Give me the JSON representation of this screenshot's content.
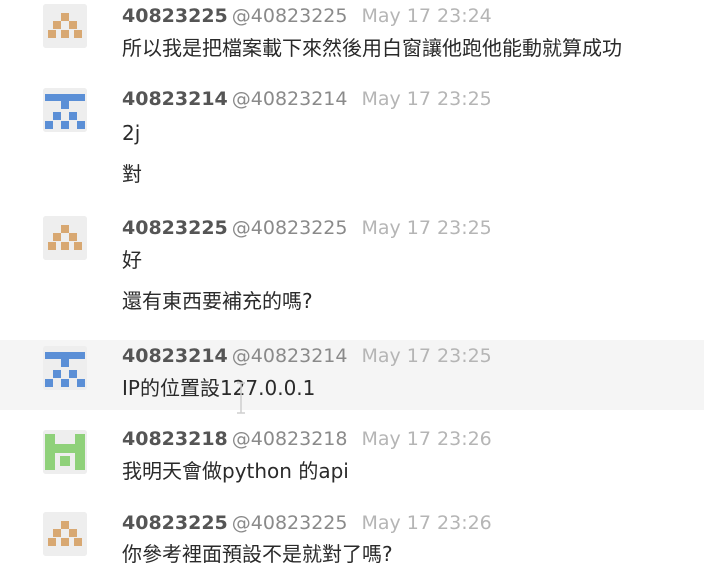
{
  "messages": [
    {
      "user": "40823225",
      "handle": "@40823225",
      "time": "May 17 23:24",
      "avatar_color": "#d8a872",
      "avatar_icon": "identicon-diamond",
      "lines": [
        "所以我是把檔案載下來然後用白窗讓他跑他能動就算成功"
      ]
    },
    {
      "user": "40823214",
      "handle": "@40823214",
      "time": "May 17 23:25",
      "avatar_color": "#5b8fd6",
      "avatar_icon": "identicon-t",
      "lines": [
        "2j",
        "對"
      ]
    },
    {
      "user": "40823225",
      "handle": "@40823225",
      "time": "May 17 23:25",
      "avatar_color": "#d8a872",
      "avatar_icon": "identicon-diamond",
      "lines": [
        "好",
        "還有東西要補充的嗎?"
      ]
    },
    {
      "user": "40823214",
      "handle": "@40823214",
      "time": "May 17 23:25",
      "avatar_color": "#5b8fd6",
      "avatar_icon": "identicon-t",
      "lines": [
        "IP的位置設127.0.0.1"
      ]
    },
    {
      "user": "40823218",
      "handle": "@40823218",
      "time": "May 17 23:26",
      "avatar_color": "#8fd17a",
      "avatar_icon": "identicon-h",
      "lines": [
        "我明天會做python 的api"
      ]
    },
    {
      "user": "40823225",
      "handle": "@40823225",
      "time": "May 17 23:26",
      "avatar_color": "#d8a872",
      "avatar_icon": "identicon-diamond",
      "lines": [
        "你參考裡面預設不是就對了嗎?"
      ]
    }
  ],
  "cursor_icon": "text-cursor-icon"
}
